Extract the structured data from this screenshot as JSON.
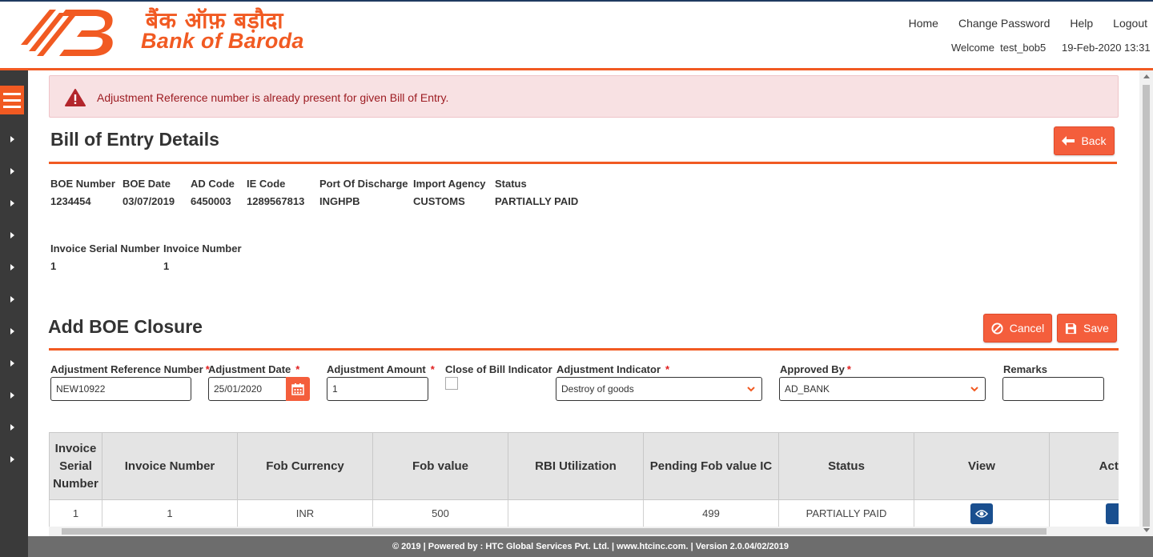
{
  "brand": {
    "name_hindi": "बैंक ऑफ़ बड़ौदा",
    "name_english": "Bank of Baroda",
    "color": "#f15a22"
  },
  "topnav": {
    "home": "Home",
    "change_password": "Change Password",
    "help": "Help",
    "logout": "Logout"
  },
  "user": {
    "welcome": "Welcome  test_bob5",
    "datetime": "19-Feb-2020 13:31"
  },
  "alert": {
    "message": "Adjustment Reference number is already present for given Bill of Entry."
  },
  "boe_details": {
    "title": "Bill of Entry Details",
    "back_label": "Back",
    "fields": [
      {
        "label": "BOE Number",
        "value": "1234454"
      },
      {
        "label": "BOE Date",
        "value": "03/07/2019"
      },
      {
        "label": "AD Code",
        "value": "6450003"
      },
      {
        "label": "IE Code",
        "value": "1289567813"
      },
      {
        "label": "Port Of Discharge",
        "value": "INGHPB"
      },
      {
        "label": "Import Agency",
        "value": "CUSTOMS"
      },
      {
        "label": "Status",
        "value": "PARTIALLY PAID"
      }
    ],
    "invoice_fields": [
      {
        "label": "Invoice Serial Number",
        "value": "1"
      },
      {
        "label": "Invoice Number",
        "value": "1"
      }
    ]
  },
  "closure": {
    "title": "Add BOE Closure",
    "cancel_label": "Cancel",
    "save_label": "Save",
    "form": {
      "adj_ref_label": "Adjustment Reference Number",
      "adj_ref_value": "NEW10922",
      "adj_date_label": "Adjustment Date",
      "adj_date_value": "25/01/2020",
      "adj_amount_label": "Adjustment Amount",
      "adj_amount_value": "1",
      "close_bill_label": "Close of Bill Indicator",
      "adj_indicator_label": "Adjustment Indicator",
      "adj_indicator_value": "Destroy of goods",
      "approved_by_label": "Approved By",
      "approved_by_value": "AD_BANK",
      "remarks_label": "Remarks",
      "remarks_value": "",
      "required_mark": "*"
    }
  },
  "table": {
    "headers": [
      "Invoice Serial Number",
      "Invoice Number",
      "Fob Currency",
      "Fob value",
      "RBI Utilization",
      "Pending Fob value IC",
      "Status",
      "View",
      "Action"
    ],
    "rows": [
      {
        "serial": "1",
        "invoice": "1",
        "currency": "INR",
        "fob": "500",
        "rbi": "",
        "pending": "499",
        "status": "PARTIALLY PAID"
      }
    ]
  },
  "footer": {
    "text": "© 2019 | Powered by : HTC Global Services Pvt. Ltd. | www.htcinc.com. | Version 2.0.04/02/2019"
  }
}
